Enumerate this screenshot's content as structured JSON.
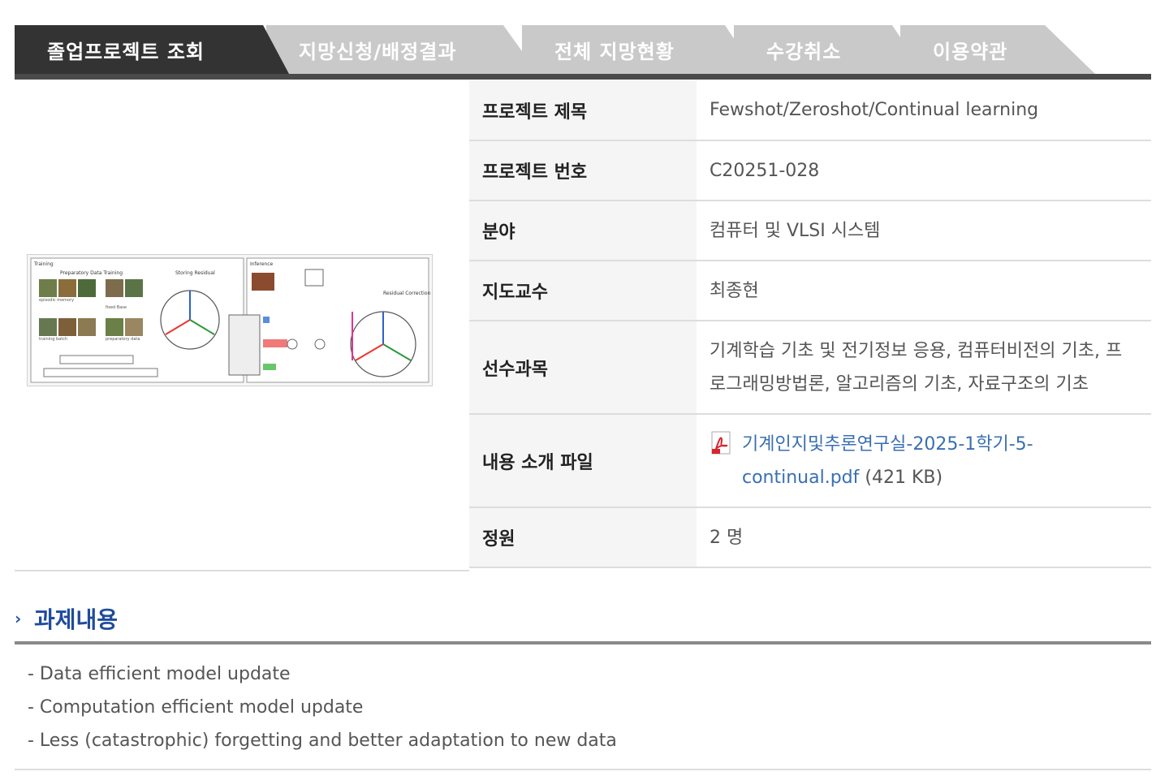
{
  "tabs": [
    {
      "label": "졸업프로젝트 조회",
      "active": true
    },
    {
      "label": "지망신청/배정결과",
      "active": false
    },
    {
      "label": "전체 지망현황",
      "active": false
    },
    {
      "label": "수강취소",
      "active": false
    },
    {
      "label": "이용약관",
      "active": false
    }
  ],
  "project": {
    "title_label": "프로젝트 제목",
    "title_value": "Fewshot/Zeroshot/Continual learning",
    "number_label": "프로젝트 번호",
    "number_value": "C20251-028",
    "field_label": "분야",
    "field_value": "컴퓨터 및 VLSI 시스템",
    "advisor_label": "지도교수",
    "advisor_value": "최종현",
    "prereq_label": "선수과목",
    "prereq_line1": "기계학습 기초 및 전기정보 응용, 컴퓨터비전의 기초, 프",
    "prereq_line2": "로그래밍방법론, 알고리즘의 기초, 자료구조의 기초",
    "file_label": "내용 소개 파일",
    "file_link_line1": "기계인지및추론연구실-2025-1학기-5-",
    "file_link_line2": "continual.pdf",
    "file_size": "(421 KB)",
    "file_icon": "pdf-icon",
    "capacity_label": "정원",
    "capacity_value": "2 명"
  },
  "thumbnail": {
    "training": "Training",
    "prep": "Preparatory Data Training",
    "storing": "Storing Residual",
    "inference": "Inference",
    "residual_correction": "Residual Correction",
    "episodic": "episodic memory",
    "fixed": "fixed Base",
    "training_batch": "training batch",
    "preparatory": "preparatory data"
  },
  "section": {
    "title": "과제내용",
    "arrow_icon": "chevron-right-icon",
    "items": [
      "- Data efficient model update",
      "- Computation efficient model update",
      "- Less (catastrophic) forgetting and better adaptation to new data"
    ]
  },
  "colors": {
    "tab_active": "#333333",
    "tab_inactive": "#c9c9c9",
    "link": "#3a6fb0",
    "section_title": "#1f4c9c"
  }
}
